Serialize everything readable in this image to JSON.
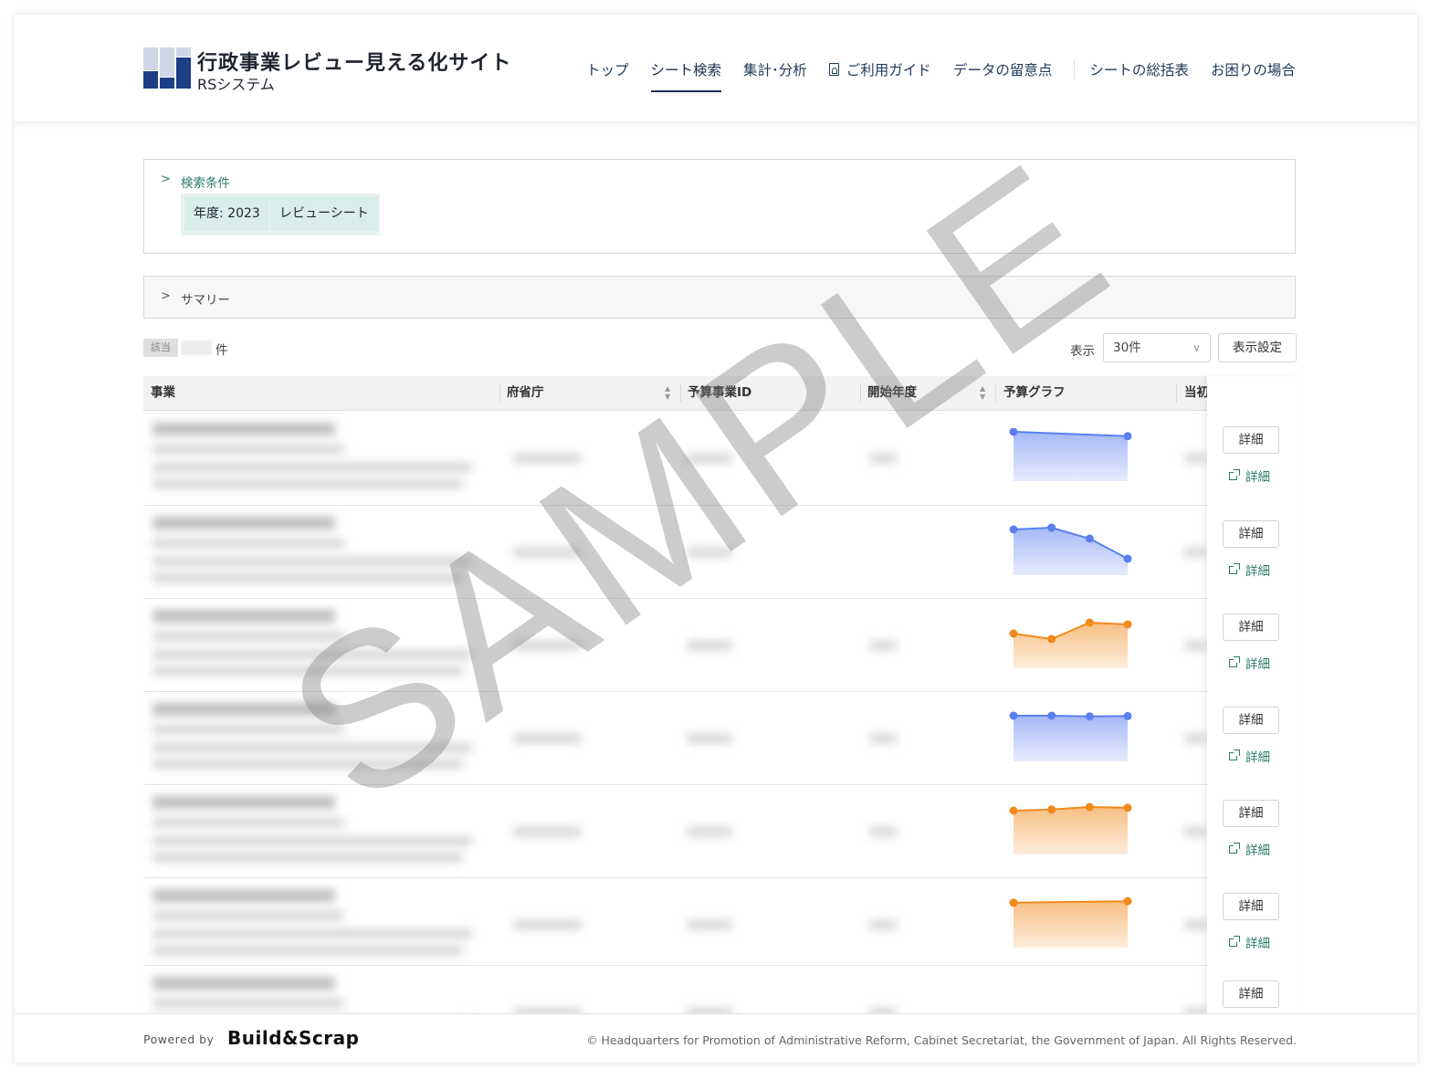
{
  "header": {
    "title": "行政事業レビュー見える化サイト",
    "subtitle": "RSシステム",
    "nav": [
      {
        "label": "トップ",
        "active": false
      },
      {
        "label": "シート検索",
        "active": true
      },
      {
        "label": "集計･分析",
        "active": false
      },
      {
        "label": "ご利用ガイド",
        "active": false,
        "icon": "pdf-icon"
      },
      {
        "label": "データの留意点",
        "active": false
      },
      {
        "label": "シートの総括表",
        "active": false
      },
      {
        "label": "お困りの場合",
        "active": false
      }
    ]
  },
  "conditions": {
    "title": "検索条件",
    "tags": [
      "年度: 2023",
      "レビューシート"
    ]
  },
  "summary": {
    "title": "サマリー"
  },
  "results": {
    "count_label": "該当",
    "count_unit": "件",
    "display_label": "表示",
    "per_page": "30件",
    "settings_button": "表示設定"
  },
  "table": {
    "columns": [
      "事業",
      "府省庁",
      "予算事業ID",
      "開始年度",
      "予算グラフ",
      "当初"
    ],
    "detail_button": "詳細",
    "detail_link": "詳細",
    "rows": [
      {
        "trend": "decreasing",
        "color": "#5b7ff0",
        "values": [
          1.0,
          0.88
        ]
      },
      {
        "trend": "decreasing",
        "color": "#5b7ff0",
        "values": [
          0.9,
          0.95,
          0.65,
          0.1
        ]
      },
      {
        "trend": "increasing",
        "color": "#f08a1c",
        "values": [
          0.6,
          0.45,
          0.9,
          0.85
        ]
      },
      {
        "trend": "flat",
        "color": "#5b7ff0",
        "values": [
          0.9,
          0.9,
          0.88,
          0.89
        ]
      },
      {
        "trend": "flat",
        "color": "#f08a1c",
        "values": [
          0.85,
          0.88,
          0.95,
          0.93
        ]
      },
      {
        "trend": "flat",
        "color": "#f08a1c",
        "values": [
          0.88,
          0.92
        ]
      }
    ]
  },
  "watermark": "SAMPLE",
  "footer": {
    "powered_by": "Powered by",
    "brand": "Build&Scrap",
    "copyright": "© Headquarters for Promotion of Administrative Reform, Cabinet Secretariat, the Government of Japan. All Rights Reserved."
  }
}
